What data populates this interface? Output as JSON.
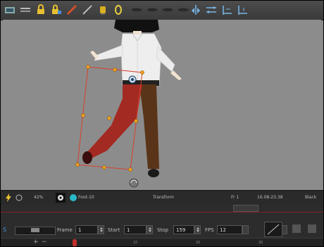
{
  "status": {
    "zoom": "42%",
    "layer_name": "Foot-10",
    "mode": "Transform",
    "frame": "Fr 1",
    "coords": "16.08-23.38",
    "color": "Black"
  },
  "timeline": {
    "frame_label": "Frame",
    "frame_value": "1",
    "start_label": "Start",
    "start_value": "1",
    "stop_label": "Stop",
    "stop_value": "159",
    "fps_label": "FPS",
    "fps_value": "12",
    "ruler_marks": [
      "10",
      "20",
      "30",
      "40",
      "50",
      "60",
      "70",
      "80",
      "90"
    ]
  },
  "colors": {
    "selection": "#d8402e",
    "handle": "#f0a020",
    "shirt": "#efefef",
    "left_pant": "#a32a22",
    "right_pant": "#5a3418"
  },
  "icons": [
    "animate-icon",
    "onion-skin-icon",
    "lock-icon",
    "lock-all-icon",
    "brush-icon",
    "pencil-icon",
    "paint-icon",
    "select-icon",
    "camera-icon",
    "deform-icon",
    "bone-icon",
    "flip-horizontal-icon",
    "flip-vertical-icon",
    "align-icon",
    "distribute-icon"
  ]
}
